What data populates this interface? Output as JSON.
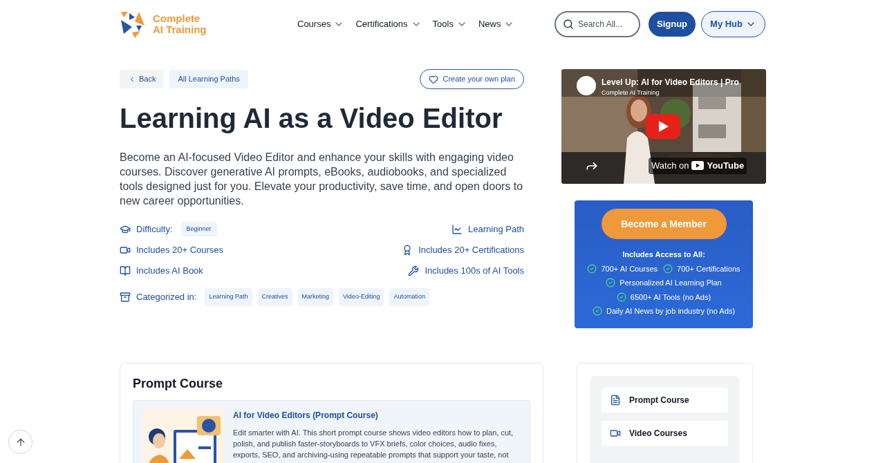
{
  "header": {
    "logo": {
      "line1": "Complete",
      "line2": "AI Training"
    },
    "nav": [
      {
        "label": "Courses"
      },
      {
        "label": "Certifications"
      },
      {
        "label": "Tools"
      },
      {
        "label": "News"
      }
    ],
    "search": {
      "placeholder": "Search All..."
    },
    "signup": "Signup",
    "hub": "My Hub"
  },
  "breadcrumbs": [
    {
      "kind": "back",
      "label": "Back"
    },
    {
      "kind": "link",
      "label": "All Learning Paths"
    }
  ],
  "create_plan": "Create your own plan",
  "title": "Learning AI as a Video Editor",
  "description": "Become an AI-focused Video Editor and enhance your skills with engaging video courses. Discover generative AI prompts, eBooks, audiobooks, and specialized tools designed just for you. Elevate your productivity, save time, and open doors to new career opportunities.",
  "fact_rows": [
    {
      "left": {
        "kind": "difficulty",
        "label": "Difficulty:",
        "tag": "Beginner"
      },
      "right": {
        "kind": "path",
        "label": "Learning Path"
      }
    },
    {
      "left": {
        "kind": "courses",
        "label": "Includes 20+ Courses"
      },
      "right": {
        "kind": "certifications",
        "label": "Includes 20+ Certifications"
      }
    },
    {
      "left": {
        "kind": "book",
        "label": "Includes AI Book"
      },
      "right": {
        "kind": "tools",
        "label": "Includes 100s of AI Tools"
      }
    }
  ],
  "categories": {
    "label": "Categorized in:",
    "tags": [
      "Learning Path",
      "Creatives",
      "Marketing",
      "Video-Editing",
      "Automation"
    ]
  },
  "video": {
    "title": "Level Up: AI for Video Editors | Pro",
    "channel": "Complete AI Training",
    "watch_on": "Watch on",
    "platform": "YouTube"
  },
  "membership": {
    "button": "Become a Member",
    "heading": "Includes Access to All:",
    "lines": [
      [
        "700+ AI Courses",
        "700+ Certifications"
      ],
      [
        "Personalized AI Learning Plan"
      ],
      [
        "6500+ AI Tools (no Ads)"
      ],
      [
        "Daily AI News by job industry (no Ads)"
      ]
    ]
  },
  "prompt_section": {
    "heading": "Prompt Course",
    "course": {
      "title": "AI for Video Editors (Prompt Course)",
      "description": "Edit smarter with AI. This short prompt course shows video editors how to plan, cut, polish, and publish faster-storyboards to VFX briefs, color choices, audio fixes, exports, SEO, and archiving-using repeatable prompts that support your taste, not"
    }
  },
  "side_nav": [
    {
      "kind": "prompt",
      "label": "Prompt Course"
    },
    {
      "kind": "video",
      "label": "Video Courses"
    }
  ]
}
